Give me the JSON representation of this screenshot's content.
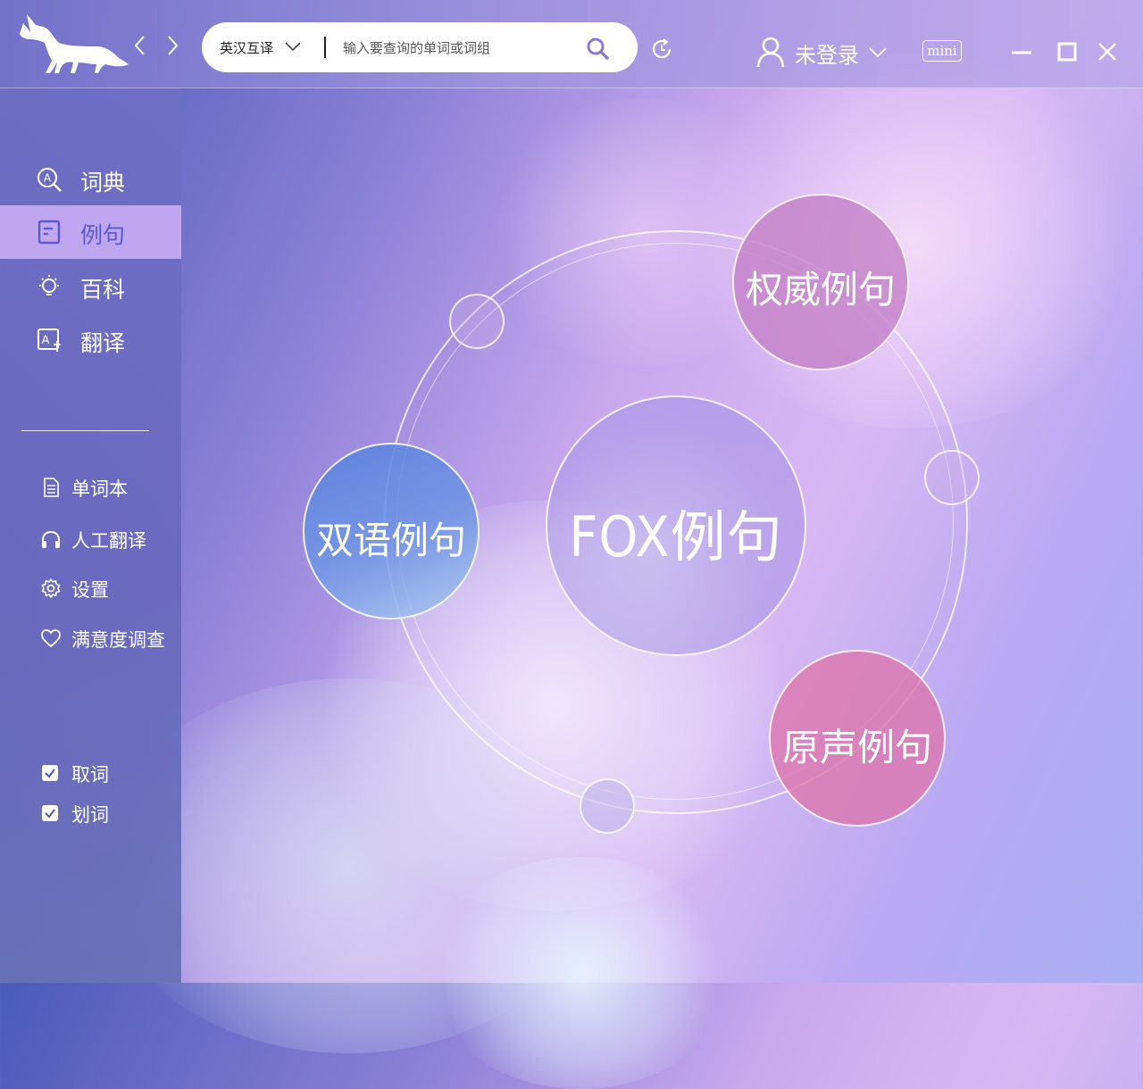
{
  "colors": {
    "active_item_bg": "#c4aaf0",
    "active_item_text": "#5a5ad0",
    "search_bg": "#ffffff"
  },
  "header": {
    "logo_icon": "fox-logo-icon",
    "back_icon": "chevron-left-icon",
    "forward_icon": "chevron-right-icon",
    "search": {
      "lang_label": "英汉互译",
      "placeholder": "输入要查询的单词或词组",
      "value": ""
    },
    "history_icon": "history-icon",
    "user": {
      "label": "未登录",
      "icon": "user-icon"
    },
    "mini_label": "mini",
    "window_icons": [
      "minimize-icon",
      "maximize-icon",
      "close-icon"
    ]
  },
  "sidebar": {
    "nav": [
      {
        "label": "词典",
        "icon": "dictionary-icon",
        "active": false
      },
      {
        "label": "例句",
        "icon": "sentence-icon",
        "active": true
      },
      {
        "label": "百科",
        "icon": "bulb-icon",
        "active": false
      },
      {
        "label": "翻译",
        "icon": "translate-icon",
        "active": false
      }
    ],
    "tools": [
      {
        "label": "单词本",
        "icon": "notebook-icon"
      },
      {
        "label": "人工翻译",
        "icon": "headphones-icon"
      },
      {
        "label": "设置",
        "icon": "gear-icon"
      },
      {
        "label": "满意度调查",
        "icon": "heart-icon"
      }
    ],
    "checks": [
      {
        "label": "取词",
        "checked": true
      },
      {
        "label": "划词",
        "checked": true
      }
    ]
  },
  "main": {
    "center_label": "FOX例句",
    "bubbles": {
      "authority": "权威例句",
      "bilingual": "双语例句",
      "original": "原声例句"
    }
  }
}
